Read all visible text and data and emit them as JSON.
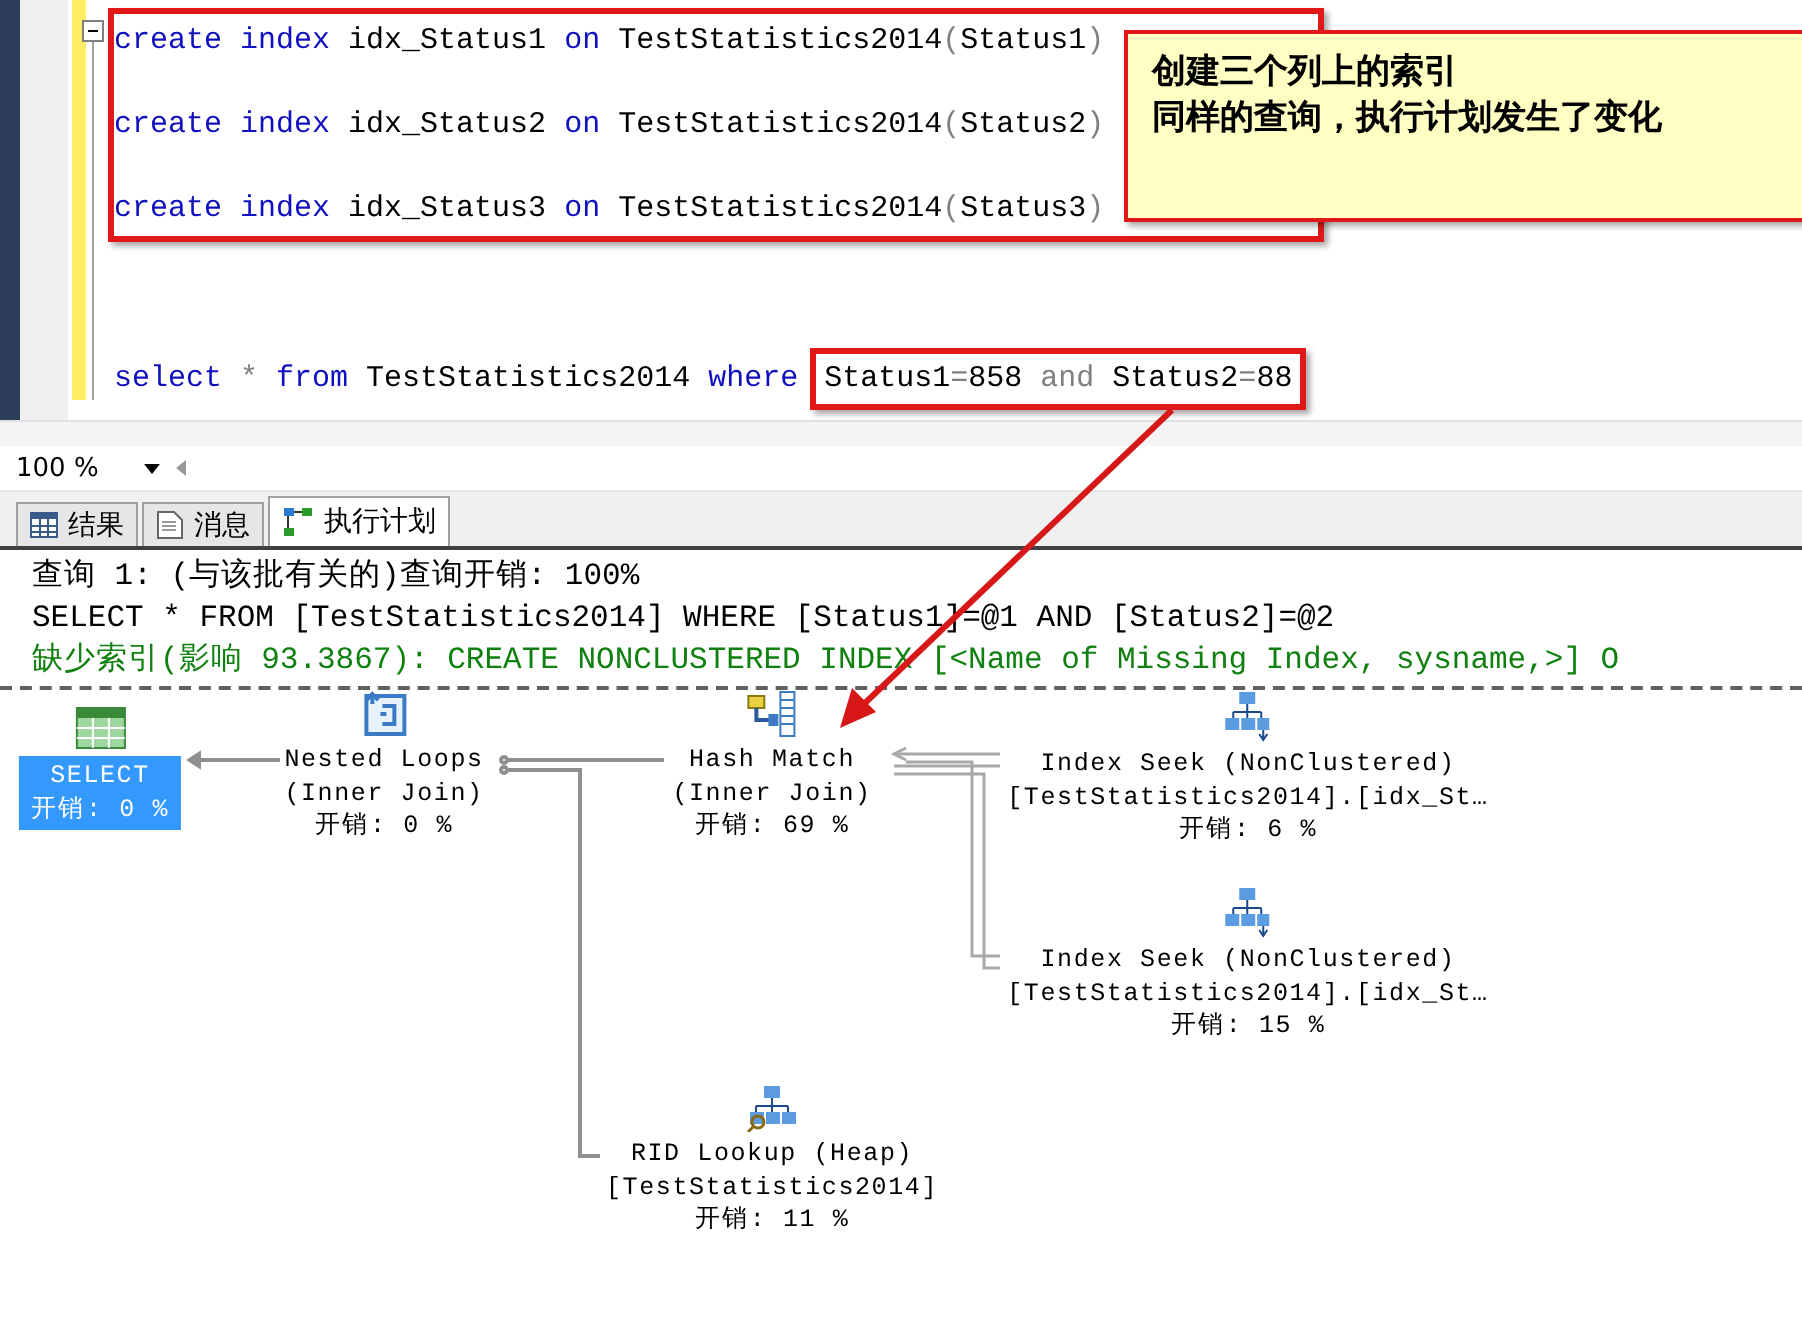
{
  "editor": {
    "code_blocks": [
      {
        "boxed": true,
        "lines": [
          {
            "tokens": [
              {
                "text": "create index ",
                "kind": "keyword"
              },
              {
                "text": "idx_Status1 ",
                "kind": "plain"
              },
              {
                "text": "on ",
                "kind": "keyword"
              },
              {
                "text": "TestStatistics2014",
                "kind": "plain"
              },
              {
                "text": "(",
                "kind": "operator"
              },
              {
                "text": "Status1",
                "kind": "plain"
              },
              {
                "text": ")",
                "kind": "operator"
              }
            ]
          },
          {
            "tokens": [
              {
                "text": "create index ",
                "kind": "keyword"
              },
              {
                "text": "idx_Status2 ",
                "kind": "plain"
              },
              {
                "text": "on ",
                "kind": "keyword"
              },
              {
                "text": "TestStatistics2014",
                "kind": "plain"
              },
              {
                "text": "(",
                "kind": "operator"
              },
              {
                "text": "Status2",
                "kind": "plain"
              },
              {
                "text": ")",
                "kind": "operator"
              }
            ]
          },
          {
            "tokens": [
              {
                "text": "create index ",
                "kind": "keyword"
              },
              {
                "text": "idx_Status3 ",
                "kind": "plain"
              },
              {
                "text": "on ",
                "kind": "keyword"
              },
              {
                "text": "TestStatistics2014",
                "kind": "plain"
              },
              {
                "text": "(",
                "kind": "operator"
              },
              {
                "text": "Status3",
                "kind": "plain"
              },
              {
                "text": ")",
                "kind": "operator"
              }
            ]
          }
        ]
      },
      {
        "boxed": false,
        "lines": [
          {
            "tokens": [
              {
                "text": "select ",
                "kind": "keyword"
              },
              {
                "text": "* ",
                "kind": "operator"
              },
              {
                "text": "from ",
                "kind": "keyword"
              },
              {
                "text": "TestStatistics2014 ",
                "kind": "plain"
              },
              {
                "text": "where",
                "kind": "keyword"
              }
            ],
            "boxed_tokens": [
              {
                "text": "Status1",
                "kind": "plain"
              },
              {
                "text": "=",
                "kind": "operator"
              },
              {
                "text": "858 ",
                "kind": "plain"
              },
              {
                "text": "and ",
                "kind": "operator"
              },
              {
                "text": "Status2",
                "kind": "plain"
              },
              {
                "text": "=",
                "kind": "operator"
              },
              {
                "text": "88",
                "kind": "plain"
              }
            ]
          }
        ]
      }
    ]
  },
  "callout": {
    "lines": [
      "创建三个列上的索引",
      "同样的查询，执行计划发生了变化"
    ]
  },
  "results_pane": {
    "zoom": "100 %",
    "tabs": [
      {
        "label": "结果",
        "kind": "grid",
        "selected": false
      },
      {
        "label": "消息",
        "kind": "messages",
        "selected": false
      },
      {
        "label": "执行计划",
        "kind": "plan",
        "selected": true
      }
    ],
    "plan": {
      "header": [
        {
          "text": "查询 1: (与该批有关的)查询开销: 100%",
          "kind": "info"
        },
        {
          "text": "SELECT * FROM [TestStatistics2014] WHERE [Status1]=@1 AND [Status2]=@2",
          "kind": "statement"
        },
        {
          "text": "缺少索引(影响 93.3867): CREATE NONCLUSTERED INDEX [<Name of Missing Index, sysname,>] O",
          "kind": "missing_index"
        }
      ],
      "nodes": [
        {
          "kind": "select",
          "lines": [
            "SELECT"
          ],
          "cost": "开销: 0 %",
          "selected": true
        },
        {
          "kind": "nested_loops",
          "lines": [
            "Nested Loops",
            "(Inner Join)"
          ],
          "cost": "开销: 0 %",
          "selected": false
        },
        {
          "kind": "hash_match",
          "lines": [
            "Hash Match",
            "(Inner Join)"
          ],
          "cost": "开销: 69 %",
          "selected": false
        },
        {
          "kind": "index_seek",
          "lines": [
            "Index Seek (NonClustered)",
            "[TestStatistics2014].[idx_St…"
          ],
          "cost": "开销: 6 %",
          "selected": false
        },
        {
          "kind": "index_seek",
          "lines": [
            "Index Seek (NonClustered)",
            "[TestStatistics2014].[idx_St…"
          ],
          "cost": "开销: 15 %",
          "selected": false
        },
        {
          "kind": "rid_lookup",
          "lines": [
            "RID Lookup (Heap)",
            "[TestStatistics2014]"
          ],
          "cost": "开销: 11 %",
          "selected": false
        }
      ]
    }
  }
}
